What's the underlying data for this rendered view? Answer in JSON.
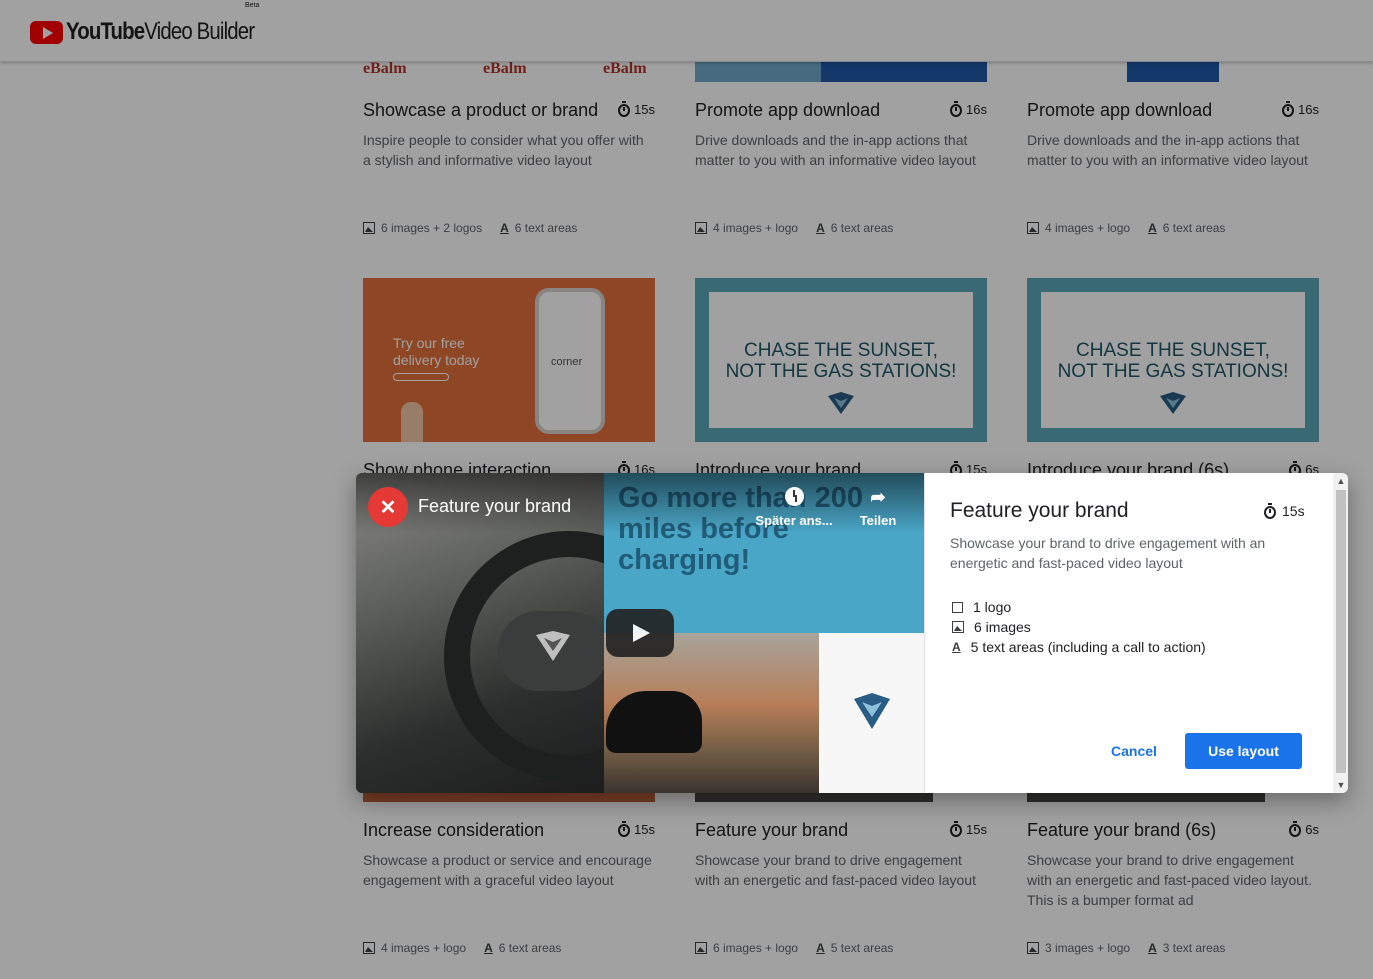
{
  "app": {
    "brand": "YouTube",
    "product": "Video Builder",
    "beta": "Beta"
  },
  "cards": [
    {
      "title": "Showcase a product or brand",
      "duration": "15s",
      "description": "Inspire people to consider what you offer with a stylish and informative video layout",
      "images": "6 images + 2 logos",
      "text_areas": "6 text areas",
      "thumb_text": "eBalm"
    },
    {
      "title": "Promote app download",
      "duration": "16s",
      "description": "Drive downloads and the in-app actions that matter to you with an informative video layout",
      "images": "4 images + logo",
      "text_areas": "6 text areas"
    },
    {
      "title": "Promote app download",
      "duration": "16s",
      "description": "Drive downloads and the in-app actions that matter to you with an informative video layout",
      "images": "4 images + logo",
      "text_areas": "6 text areas"
    },
    {
      "title": "Show phone interaction",
      "duration": "16s",
      "thumb_text": "Try our free delivery today",
      "thumb_brand": "corner"
    },
    {
      "title": "Introduce your brand",
      "duration": "15s",
      "thumb_text": "CHASE THE SUNSET, NOT THE GAS STATIONS!"
    },
    {
      "title": "Introduce your brand (6s)",
      "duration": "6s",
      "thumb_text": "CHASE THE SUNSET, NOT THE GAS STATIONS!"
    },
    {
      "title": "Increase consideration",
      "duration": "15s",
      "description": "Showcase a product or service and encourage engagement with a graceful video layout",
      "images": "4 images + logo",
      "text_areas": "6 text areas"
    },
    {
      "title": "Feature your brand",
      "duration": "15s",
      "description": "Showcase your brand to drive engagement with an energetic and fast-paced video layout",
      "images": "6 images + logo",
      "text_areas": "5 text areas"
    },
    {
      "title": "Feature your brand (6s)",
      "duration": "6s",
      "description": "Showcase your brand to drive engagement with an energetic and fast-paced video layout. This is a bumper format ad",
      "images": "3 images + logo",
      "text_areas": "3 text areas"
    }
  ],
  "dialog": {
    "video": {
      "title": "Feature your brand",
      "watch_later": "Später ans...",
      "share": "Teilen",
      "overlay_text": "Go more than 200 miles before charging!"
    },
    "title": "Feature your brand",
    "duration": "15s",
    "description": "Showcase your brand to drive engagement with an energetic and fast-paced video layout",
    "assets": [
      "1 logo",
      "6 images",
      "5 text areas (including a call to action)"
    ],
    "cancel_label": "Cancel",
    "use_label": "Use layout"
  }
}
